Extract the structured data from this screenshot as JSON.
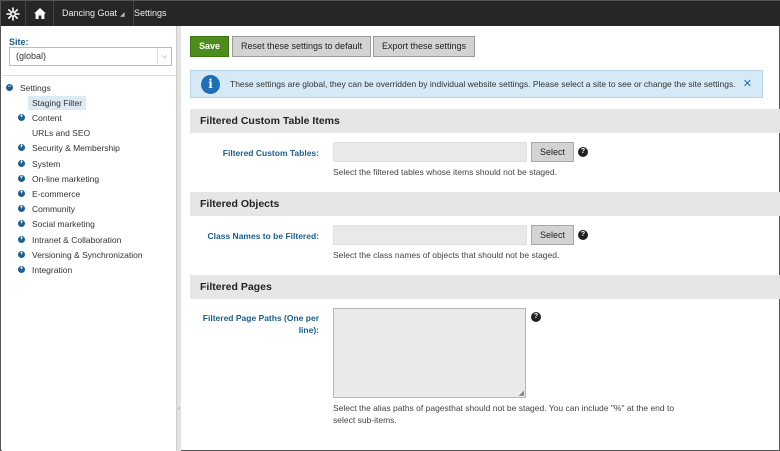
{
  "topbar": {
    "site_name": "Dancing Goat",
    "app_name": "Settings"
  },
  "sidebar": {
    "site_label": "Site:",
    "site_value": "(global)",
    "tree": {
      "root": "Settings",
      "items": [
        {
          "label": "Staging Filter",
          "selected": true,
          "expandable": false
        },
        {
          "label": "Content",
          "expandable": true
        },
        {
          "label": "URLs and SEO",
          "expandable": false
        },
        {
          "label": "Security & Membership",
          "expandable": true
        },
        {
          "label": "System",
          "expandable": true
        },
        {
          "label": "On-line marketing",
          "expandable": true
        },
        {
          "label": "E-commerce",
          "expandable": true
        },
        {
          "label": "Community",
          "expandable": true
        },
        {
          "label": "Social marketing",
          "expandable": true
        },
        {
          "label": "Intranet & Collaboration",
          "expandable": true
        },
        {
          "label": "Versioning & Synchronization",
          "expandable": true
        },
        {
          "label": "Integration",
          "expandable": true
        }
      ]
    }
  },
  "toolbar": {
    "save_label": "Save",
    "reset_label": "Reset these settings to default",
    "export_label": "Export these settings"
  },
  "info": {
    "message": "These settings are global, they can be overridden by individual website settings. Please select a site to see or change the site settings."
  },
  "sections": {
    "custom_tables": {
      "title": "Filtered Custom Table Items",
      "field_label": "Filtered Custom Tables:",
      "button_label": "Select",
      "hint": "Select the filtered tables whose items should not be staged."
    },
    "objects": {
      "title": "Filtered Objects",
      "field_label": "Class Names to be Filtered:",
      "button_label": "Select",
      "hint": "Select the class names of objects that should not be staged."
    },
    "pages": {
      "title": "Filtered Pages",
      "field_label_line1": "Filtered Page Paths (One per",
      "field_label_line2": "line):",
      "hint_line1": "Select the alias paths of pagesthat should not be staged. You can include \"%\" at the end to",
      "hint_line2": "select sub-items."
    }
  },
  "colors": {
    "save": "#4c8c1c",
    "accent": "#1b5d8c",
    "info_bg": "#d5eaf6"
  }
}
